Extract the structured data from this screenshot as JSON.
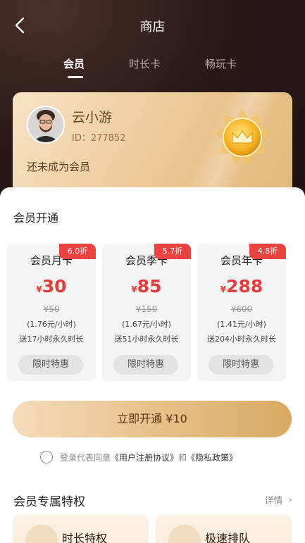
{
  "header": {
    "title": "商店",
    "back_icon": "chevron-left-icon"
  },
  "tabs": [
    {
      "label": "会员",
      "active": true
    },
    {
      "label": "时长卡",
      "active": false
    },
    {
      "label": "畅玩卡",
      "active": false
    }
  ],
  "vip_card": {
    "user_name": "云小游",
    "user_id": "ID：277852",
    "status": "还未成为会员",
    "medal_icon": "crown-medal-icon"
  },
  "membership": {
    "section_title": "会员开通",
    "plans": [
      {
        "name": "会员月卡",
        "discount": "6.0折",
        "currency": "¥",
        "price": "30",
        "original": "¥50",
        "hourly": "(1.76元/小时)",
        "bonus": "送17小时永久时长",
        "tag": "限时特惠"
      },
      {
        "name": "会员季卡",
        "discount": "5.7折",
        "currency": "¥",
        "price": "85",
        "original": "¥150",
        "hourly": "(1.67元/小时)",
        "bonus": "送51小时永久时长",
        "tag": "限时特惠"
      },
      {
        "name": "会员年卡",
        "discount": "4.8折",
        "currency": "¥",
        "price": "288",
        "original": "¥600",
        "hourly": "(1.41元/小时)",
        "bonus": "送204小时永久时长",
        "tag": "限时特惠"
      }
    ],
    "open_button": "立即开通 ¥10"
  },
  "agreement": {
    "prefix": "登录代表同意",
    "user_agreement": "《用户注册协议》",
    "and": "和",
    "privacy_policy": "《隐私政策》"
  },
  "privileges": {
    "section_title": "会员专属特权",
    "details_label": "详情",
    "items": [
      {
        "title": "时长特权"
      },
      {
        "title": "极速排队"
      }
    ]
  },
  "colors": {
    "accent_red": "#e8433f",
    "gold_start": "#f4dcbb",
    "gold_end": "#d9a962",
    "dark_bg": "#1c1210"
  }
}
